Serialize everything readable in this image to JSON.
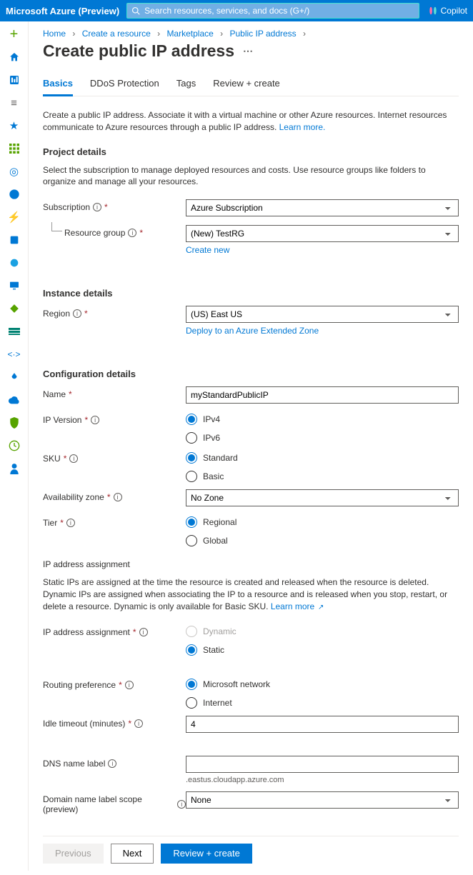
{
  "header": {
    "brand": "Microsoft Azure (Preview)",
    "search_placeholder": "Search resources, services, and docs (G+/)",
    "copilot": "Copilot"
  },
  "breadcrumbs": {
    "items": [
      "Home",
      "Create a resource",
      "Marketplace",
      "Public IP address"
    ]
  },
  "page": {
    "title": "Create public IP address"
  },
  "tabs": {
    "items": [
      "Basics",
      "DDoS Protection",
      "Tags",
      "Review + create"
    ],
    "active": 0
  },
  "intro": {
    "text": "Create a public IP address. Associate it with a virtual machine or other Azure resources. Internet resources communicate to Azure resources through a public IP address. ",
    "learn_more": "Learn more."
  },
  "sections": {
    "project": {
      "title": "Project details",
      "desc": "Select the subscription to manage deployed resources and costs. Use resource groups like folders to organize and manage all your resources.",
      "subscription_label": "Subscription",
      "subscription_value": "Azure Subscription",
      "rg_label": "Resource group",
      "rg_value": "(New) TestRG",
      "create_new": "Create new"
    },
    "instance": {
      "title": "Instance details",
      "region_label": "Region",
      "region_value": "(US) East US",
      "deploy_link": "Deploy to an Azure Extended Zone"
    },
    "config": {
      "title": "Configuration details",
      "name_label": "Name",
      "name_value": "myStandardPublicIP",
      "ipversion_label": "IP Version",
      "ipversion_options": [
        "IPv4",
        "IPv6"
      ],
      "ipversion_selected": "IPv4",
      "sku_label": "SKU",
      "sku_options": [
        "Standard",
        "Basic"
      ],
      "sku_selected": "Standard",
      "az_label": "Availability zone",
      "az_value": "No Zone",
      "tier_label": "Tier",
      "tier_options": [
        "Regional",
        "Global"
      ],
      "tier_selected": "Regional"
    },
    "ipassign": {
      "heading": "IP address assignment",
      "desc_pre": "Static IPs are assigned at the time the resource is created and released when the resource is deleted. Dynamic IPs are assigned when associating the IP to a resource and is released when you stop, restart, or delete a resource. Dynamic is only available for Basic SKU. ",
      "learn_more": "Learn more",
      "label": "IP address assignment",
      "options": [
        "Dynamic",
        "Static"
      ],
      "selected": "Static",
      "routing_label": "Routing preference",
      "routing_options": [
        "Microsoft network",
        "Internet"
      ],
      "routing_selected": "Microsoft network",
      "idle_label": "Idle timeout (minutes)",
      "idle_value": "4",
      "dns_label": "DNS name label",
      "dns_value": "",
      "dns_suffix": ".eastus.cloudapp.azure.com",
      "scope_label": "Domain name label scope (preview)",
      "scope_value": "None"
    }
  },
  "footer": {
    "previous": "Previous",
    "next": "Next",
    "review": "Review + create"
  }
}
